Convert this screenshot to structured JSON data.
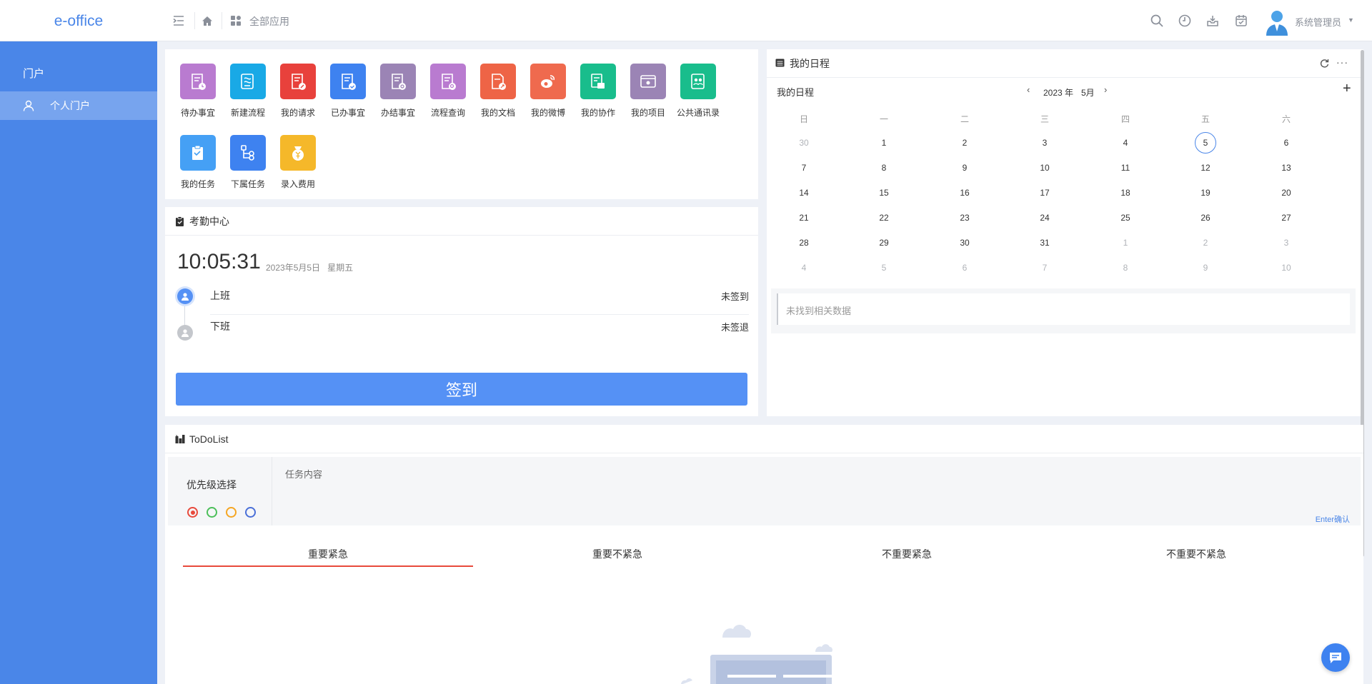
{
  "header": {
    "logo": "e-office",
    "all_apps_label": "全部应用",
    "user_name": "系统管理员"
  },
  "sidebar": {
    "section_title": "门户",
    "items": [
      {
        "label": "个人门户"
      }
    ]
  },
  "apps": [
    {
      "label": "待办事宜",
      "color": "#b97bd0",
      "icon": "todo-doc-icon"
    },
    {
      "label": "新建流程",
      "color": "#19a9e6",
      "icon": "new-flow-icon"
    },
    {
      "label": "我的请求",
      "color": "#e8413c",
      "icon": "my-request-icon"
    },
    {
      "label": "已办事宜",
      "color": "#3e82f0",
      "icon": "done-icon"
    },
    {
      "label": "办结事宜",
      "color": "#9b84b5",
      "icon": "finished-icon"
    },
    {
      "label": "流程查询",
      "color": "#b97bd0",
      "icon": "flow-query-icon"
    },
    {
      "label": "我的文档",
      "color": "#ee6446",
      "icon": "my-doc-icon"
    },
    {
      "label": "我的微博",
      "color": "#ef6a4e",
      "icon": "weibo-icon"
    },
    {
      "label": "我的协作",
      "color": "#19bd8c",
      "icon": "collab-icon"
    },
    {
      "label": "我的项目",
      "color": "#9b84b5",
      "icon": "project-icon"
    },
    {
      "label": "公共通讯录",
      "color": "#19bd8c",
      "icon": "contacts-icon"
    },
    {
      "label": "我的任务",
      "color": "#45a0f5",
      "icon": "task-icon"
    },
    {
      "label": "下属任务",
      "color": "#3e82f0",
      "icon": "sub-task-icon"
    },
    {
      "label": "录入费用",
      "color": "#f5b82a",
      "icon": "expense-icon"
    }
  ],
  "attendance": {
    "title": "考勤中心",
    "time": "10:05:31",
    "date": "2023年5月5日",
    "weekday": "星期五",
    "rows": [
      {
        "label": "上班",
        "status": "未签到"
      },
      {
        "label": "下班",
        "status": "未签退"
      }
    ],
    "sign_button": "签到"
  },
  "schedule": {
    "title": "我的日程",
    "sub_title": "我的日程",
    "year": "2023 年",
    "month": "5月",
    "weekdays": [
      "日",
      "一",
      "二",
      "三",
      "四",
      "五",
      "六"
    ],
    "weeks": [
      [
        "30",
        "1",
        "2",
        "3",
        "4",
        "5",
        "6"
      ],
      [
        "7",
        "8",
        "9",
        "10",
        "11",
        "12",
        "13"
      ],
      [
        "14",
        "15",
        "16",
        "17",
        "18",
        "19",
        "20"
      ],
      [
        "21",
        "22",
        "23",
        "24",
        "25",
        "26",
        "27"
      ],
      [
        "28",
        "29",
        "30",
        "31",
        "1",
        "2",
        "3"
      ],
      [
        "4",
        "5",
        "6",
        "7",
        "8",
        "9",
        "10"
      ]
    ],
    "empty_text": "未找到相关数据"
  },
  "todo": {
    "title": "ToDoList",
    "priority_label": "优先级选择",
    "priority_colors": [
      "#e84a3c",
      "#4cbf5a",
      "#f5a623",
      "#4a6fd8"
    ],
    "content_placeholder": "任务内容",
    "enter_hint": "Enter确认",
    "tabs": [
      "重要紧急",
      "重要不紧急",
      "不重要紧急",
      "不重要不紧急"
    ]
  }
}
